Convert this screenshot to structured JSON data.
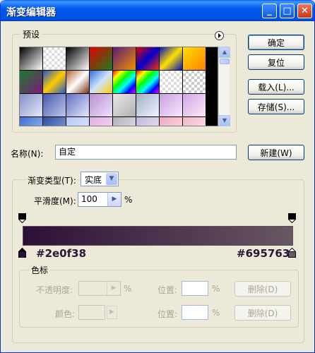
{
  "window": {
    "title": "渐变编辑器"
  },
  "titlebar": {
    "minimize": "_",
    "maximize": "□",
    "close": "✕"
  },
  "presets": {
    "label": "预设",
    "swatches": [
      "linear-gradient(135deg,#000,#fff)",
      "repeating-conic-gradient(#ddd 0 25%, #fff 0 50%) 0 0/8px 8px",
      "linear-gradient(135deg,#000,#fff)",
      "linear-gradient(135deg,#e00000,#1c7d1c)",
      "linear-gradient(135deg,#5a1c7a,#f09000)",
      "linear-gradient(135deg,#e00000,#0000d0,#ff3000)",
      "linear-gradient(135deg,#0010c0,#ffe000,#0010c0)",
      "linear-gradient(135deg,#ffe000,#ff8000)",
      "linear-gradient(135deg,#1d7a2a,#7a1a7a)",
      "linear-gradient(135deg,#2255cc,#ffcc00,#2255cc)",
      "linear-gradient(135deg,#b06030,#ffffff,#7a3010)",
      "linear-gradient(135deg,#2f6fd8,#cfe4ff,#ffcc00)",
      "linear-gradient(135deg,#ff0000,#ffff00,#00ff00,#00ffff,#0000ff,#ff00ff)",
      "linear-gradient(135deg,#ff0000,#ffff00,#00ff00,#00ffff,#0000ff,#ff00ff)",
      "repeating-conic-gradient(#ddd 0 25%, #fff 0 50%) 0 0/8px 8px",
      "repeating-conic-gradient(#ccc 0 25%, #fff 0 50%) 0 0/8px 8px",
      "linear-gradient(135deg,#8090c8,#e8e8f8)",
      "linear-gradient(135deg,#4458a8,#c0c8f0)",
      "linear-gradient(135deg,#6070c0,#e6e6ff)",
      "linear-gradient(135deg,#b890d0,#f0e0ff)",
      "linear-gradient(135deg,#e8e8e8,#b0b0b0)",
      "linear-gradient(135deg,#a0b0c8,#f0f4ff)",
      "linear-gradient(135deg,#c8a0e0,#f8e8ff)",
      "linear-gradient(135deg,#d0a8e8,#ffe8f8)",
      "linear-gradient(135deg,#4070d0,#a0c0f0)",
      "linear-gradient(135deg,#3050a0,#90a8e0)",
      "linear-gradient(135deg,#b8c8f8,#e0e8ff)",
      "linear-gradient(135deg,#e0b0e0,#f8e0f8)",
      "linear-gradient(135deg,#b0b0b8,#e8e8f0)",
      "linear-gradient(135deg,#c0b8d8,#ece8f8)",
      "linear-gradient(135deg,#f0a8c0,#ffe0e8)",
      "linear-gradient(135deg,#f0b8c8,#ffe8ee)"
    ],
    "menu_icon": "right-arrow-circle-icon"
  },
  "buttons": {
    "ok": "确定",
    "reset": "复位",
    "load": "载入(L)...",
    "save": "存储(S)...",
    "new": "新建(W)"
  },
  "name": {
    "label": "名称(N):",
    "value": "自定"
  },
  "gradient": {
    "type_label": "渐变类型(T):",
    "type_value": "实底",
    "smoothness_label": "平滑度(M):",
    "smoothness_value": "100",
    "smoothness_unit": "%",
    "start_color": "#2e0f38",
    "end_color": "#695763"
  },
  "stops": {
    "label": "色标",
    "opacity_label": "不透明度:",
    "opacity_unit": "%",
    "position_label_1": "位置:",
    "position_unit_1": "%",
    "delete_1": "删除(D)",
    "color_label": "颜色:",
    "position_label_2": "位置:",
    "position_unit_2": "%",
    "delete_2": "删除(D)"
  }
}
